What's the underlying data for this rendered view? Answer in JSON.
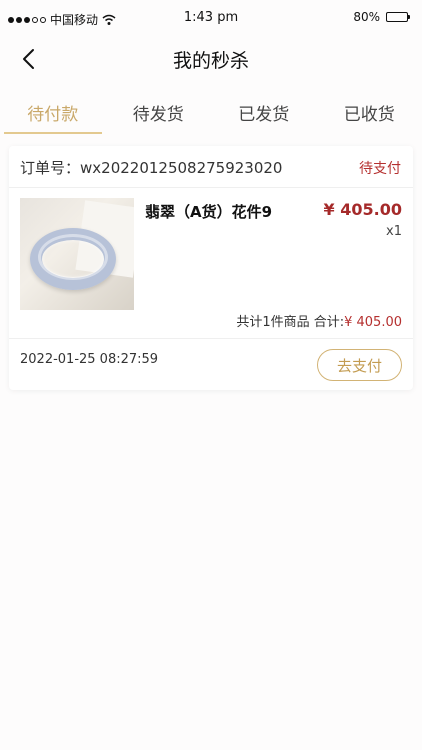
{
  "status_bar": {
    "carrier": "中国移动",
    "time": "1:43 pm",
    "battery": "80%",
    "battery_level": 0.8
  },
  "header": {
    "title": "我的秒杀",
    "back_icon": "chevron-left-icon"
  },
  "tabs": [
    {
      "label": "待付款",
      "active": true
    },
    {
      "label": "待发货",
      "active": false
    },
    {
      "label": "已发货",
      "active": false
    },
    {
      "label": "已收货",
      "active": false
    }
  ],
  "order": {
    "number": "订单号：wx2022012508275923020",
    "status": "待支付",
    "product": {
      "name": "翡翠（A货）花件9",
      "price": "¥ 405.00",
      "quantity": "x1"
    },
    "summary_text": "共计1件商品 合计:",
    "summary_amount": "¥ 405.00",
    "time": "2022-01-25 08:27:59",
    "pay_button": "去支付"
  },
  "colors": {
    "accent_gold": "#c9a869",
    "price_red": "#a52a2a",
    "status_red": "#b5302f"
  }
}
